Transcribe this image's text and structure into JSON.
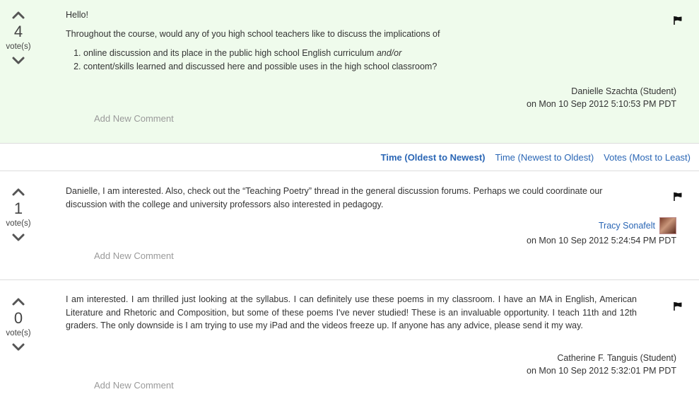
{
  "posts": [
    {
      "votes": "4",
      "vote_label": "vote(s)",
      "greeting": "Hello!",
      "intro": "Throughout the course, would any of you high school teachers like to discuss the implications of",
      "list": [
        {
          "text": "online discussion and its place in the public high school English curriculum ",
          "emph": "and/or"
        },
        {
          "text": "content/skills learned and discussed here and possible uses in the high school classroom?",
          "emph": ""
        }
      ],
      "author": "Danielle Szachta (Student)",
      "timestamp": "on Mon 10 Sep 2012 5:10:53 PM PDT",
      "add_comment": "Add New Comment"
    },
    {
      "votes": "1",
      "vote_label": "vote(s)",
      "text": "Danielle, I am interested. Also, check out the “Teaching Poetry” thread in the general discussion forums. Perhaps we could coordinate our discussion with the college and university professors also interested in pedagogy.",
      "author": "Tracy Sonafelt",
      "timestamp": "on Mon 10 Sep 2012 5:24:54 PM PDT",
      "add_comment": "Add New Comment"
    },
    {
      "votes": "0",
      "vote_label": "vote(s)",
      "text": "I am interested. I am thrilled just looking at the syllabus. I can definitely use these poems in my classroom. I have an MA in English, American Literature and Rhetoric and Composition, but some of these poems I've never studied! These is an invaluable opportunity. I teach 11th and 12th graders. The only downside is I am trying to use my iPad and the videos freeze up. If anyone has any advice, please send it my way.",
      "author": "Catherine F. Tanguis (Student)",
      "timestamp": "on Mon 10 Sep 2012 5:32:01 PM PDT",
      "add_comment": "Add New Comment"
    }
  ],
  "sort": {
    "oldest": "Time (Oldest to Newest)",
    "newest": "Time (Newest to Oldest)",
    "votes": "Votes (Most to Least)",
    "active": "oldest"
  },
  "colors": {
    "op_background": "#effbec",
    "link": "#2a66b5",
    "muted": "#9a9a9a"
  },
  "icons": {
    "upvote": "chevron-up-icon",
    "downvote": "chevron-down-icon",
    "flag": "flag-icon"
  }
}
